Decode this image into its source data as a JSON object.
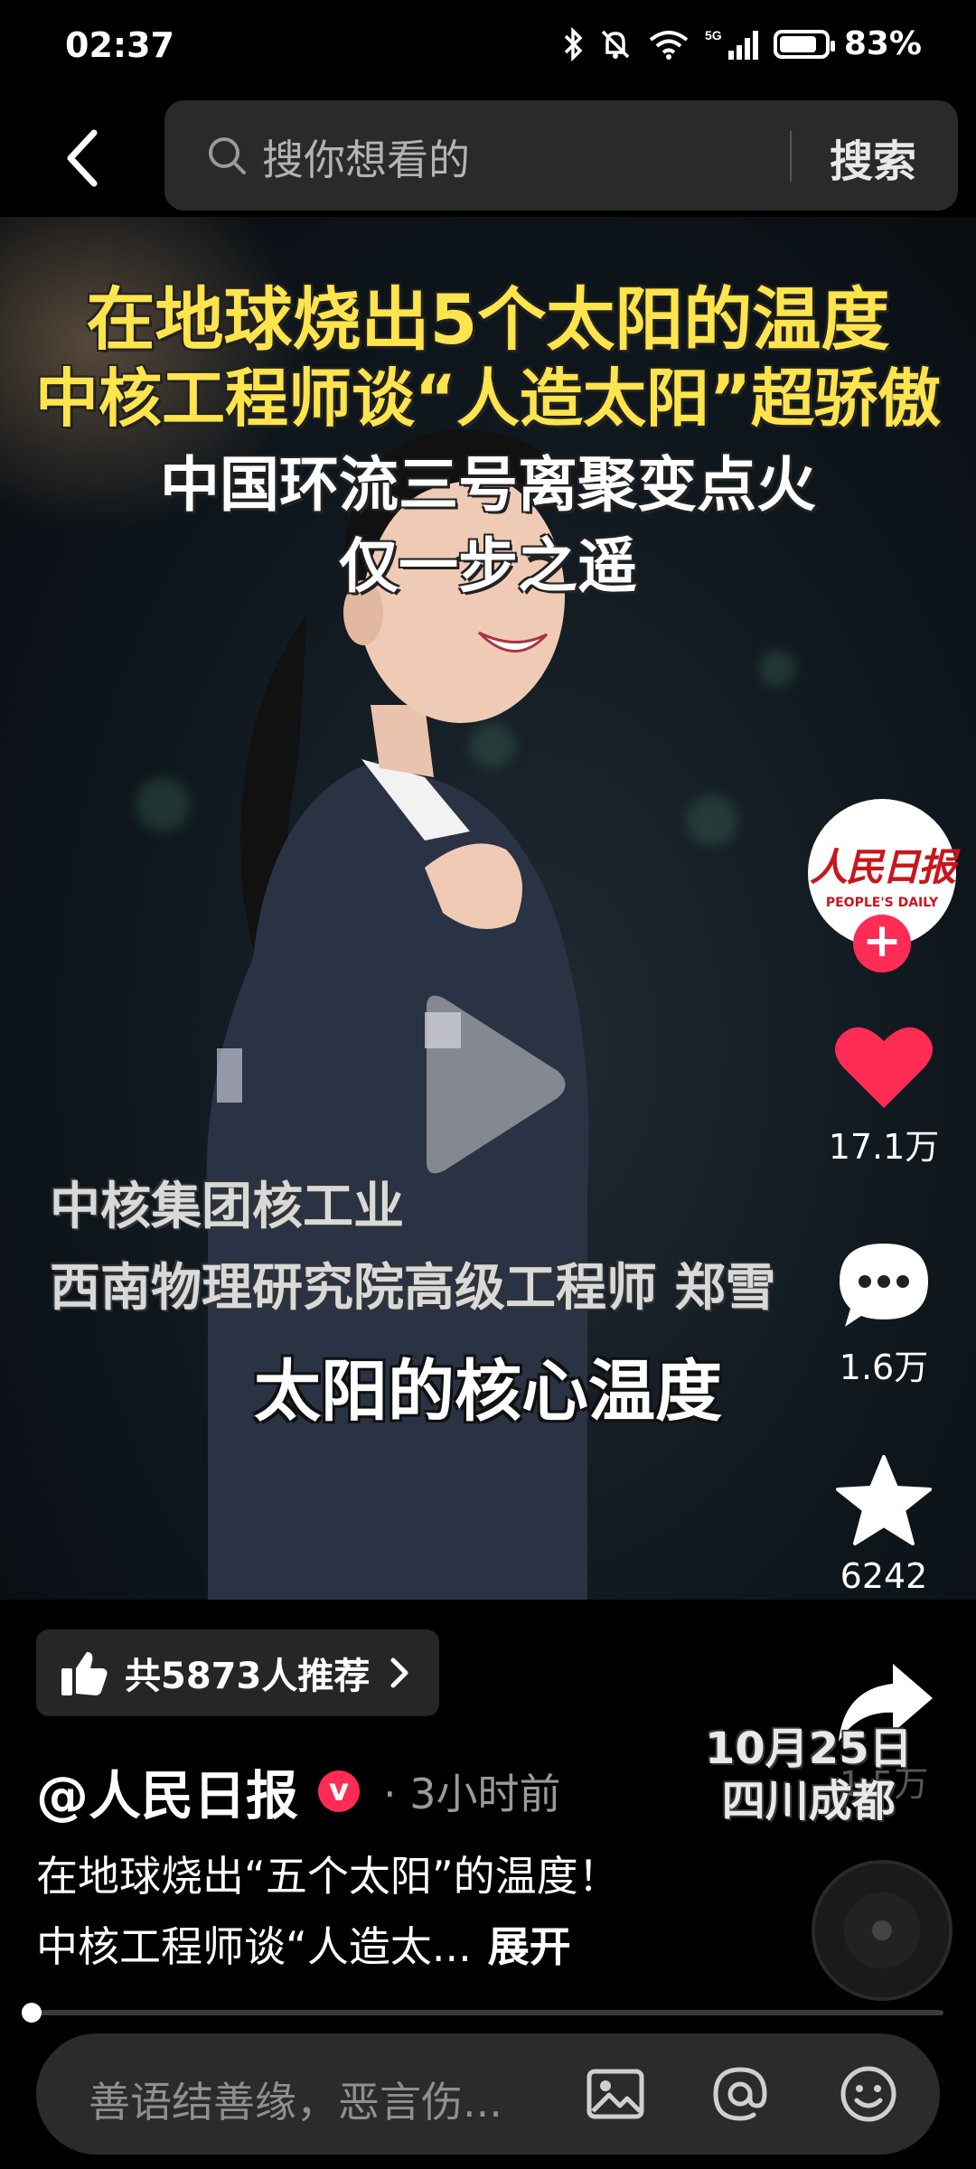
{
  "status_bar": {
    "time": "02:37",
    "battery": "83%",
    "battery_level": 0.83,
    "icons": [
      "bluetooth-icon",
      "mute-bell-icon",
      "wifi-icon",
      "5g-signal-icon",
      "battery-icon"
    ]
  },
  "search": {
    "placeholder": "搜你想看的",
    "button_label": "搜索"
  },
  "video": {
    "title_lines": [
      "在地球烧出5个太阳的温度",
      "中核工程师谈“人造太阳”超骄傲",
      "中国环流三号离聚变点火",
      "仅一步之遥"
    ],
    "speaker_lines": [
      "中核集团核工业",
      "西南物理研究院高级工程师 郑雪"
    ],
    "caption": "太阳的核心温度",
    "date_line1": "10月25日",
    "date_line2": "四川成都"
  },
  "author_avatar": {
    "logo_cn": "人民日报",
    "logo_en": "PEOPLE'S DAILY"
  },
  "actions": {
    "like_count": "17.1万",
    "comment_count": "1.6万",
    "favorite_count": "6242",
    "share_count": "1.5万"
  },
  "recommend": {
    "label": "共5873人推荐"
  },
  "post": {
    "author": "@人民日报",
    "verified_badge": "v",
    "time_ago": "· 3小时前",
    "desc_line1": "在地球烧出“五个太阳”的温度！",
    "desc_line2": "中核工程师谈“人造太...",
    "expand_label": "展开"
  },
  "progress": {
    "fraction": 0.01
  },
  "comment_input": {
    "placeholder": "善语结善缘，恶言伤..."
  },
  "colors": {
    "accent": "#fe2c55",
    "title_yellow": "#ffe44d"
  }
}
